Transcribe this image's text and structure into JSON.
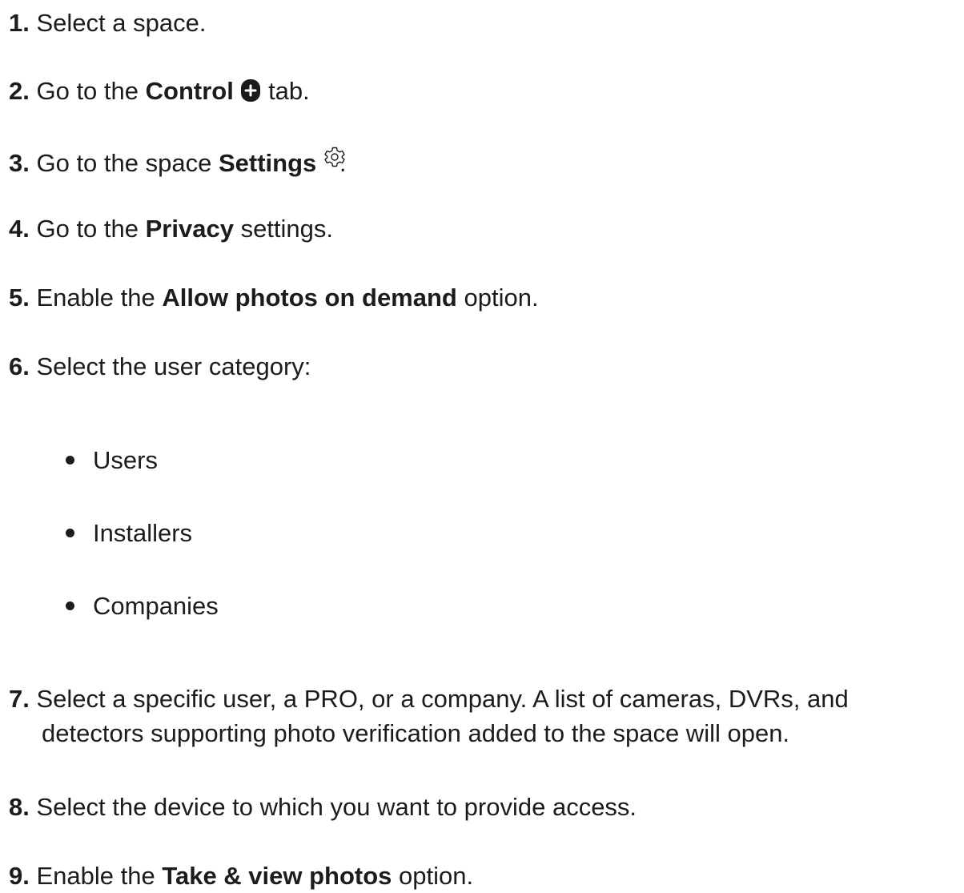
{
  "steps": [
    {
      "num": "1.",
      "text": " Select a space."
    },
    {
      "num": "2.",
      "pre": " Go to the ",
      "bold": "Control",
      "icon": "plus-tab-icon",
      "post": " tab."
    },
    {
      "num": "3.",
      "pre": " Go to the space ",
      "bold": "Settings",
      "icon": "gear-icon",
      "post": "."
    },
    {
      "num": "4.",
      "pre": " Go to the ",
      "bold": "Privacy",
      "post": " settings."
    },
    {
      "num": "5.",
      "pre": " Enable the ",
      "bold": "Allow photos on demand",
      "post": " option."
    },
    {
      "num": "6.",
      "text": " Select the user category:"
    },
    {
      "num": "7.",
      "line1": " Select a specific user, a PRO, or a company. A list of cameras, DVRs, and",
      "line2": "detectors supporting photo verification added to the space will open."
    },
    {
      "num": "8.",
      "text": " Select the device to which you want to provide access."
    },
    {
      "num": "9.",
      "pre": " Enable the ",
      "bold": "Take & view photos",
      "post": " option."
    }
  ],
  "categories": [
    "Users",
    "Installers",
    "Companies"
  ]
}
